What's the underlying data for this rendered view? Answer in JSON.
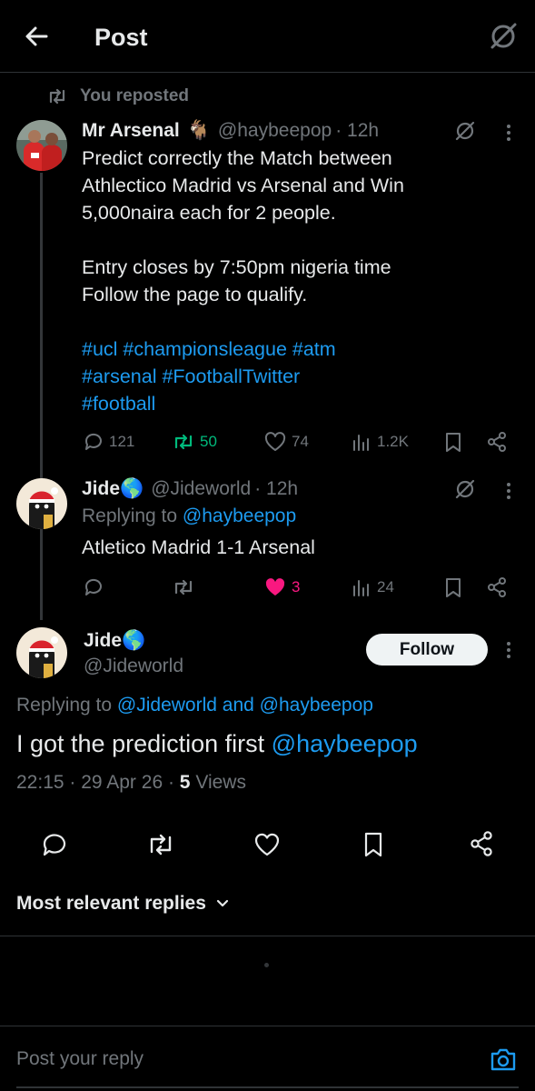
{
  "header": {
    "title": "Post"
  },
  "repost": {
    "label": "You reposted"
  },
  "original_post": {
    "name": "Mr Arsenal",
    "emoji": "🐐",
    "handle": "@haybeepop",
    "time": "· 12h",
    "lines": [
      "Predict correctly the Match between",
      "Athlectico Madrid vs Arsenal and Win",
      "5,000naira each for 2 people.",
      "Entry closes by 7:50pm nigeria time",
      "Follow the page to qualify."
    ],
    "hashtags_line1": "#ucl #championsleague #atm",
    "hashtags_line2": "#arsenal #FootballTwitter",
    "hashtags_line3": "#football",
    "replies": "121",
    "reposts": "50",
    "likes": "74",
    "views": "1.2K",
    "colors": {
      "repost_active": "#00ba7c"
    }
  },
  "reply_post": {
    "name": "Jide",
    "emoji": "🌎",
    "handle": "@Jideworld",
    "time": "· 12h",
    "replying_prefix": "Replying to",
    "replying_to": "@haybeepop",
    "text": "Atletico Madrid 1-1 Arsenal",
    "likes": "3",
    "views": "24",
    "colors": {
      "like_active": "#f91880"
    }
  },
  "main_post": {
    "name": "Jide",
    "emoji": "🌎",
    "handle": "@Jideworld",
    "follow_label": "Follow",
    "replying_prefix": "Replying to",
    "replying_to_1": "@Jideworld",
    "replying_and": "and",
    "replying_to_2": "@haybeepop",
    "text": "I got the prediction first",
    "text_mention": "@haybeepop",
    "time": "22:15 · 29 Apr 26 ·",
    "views_count": "5",
    "views_label": "Views"
  },
  "replies_sort": {
    "label": "Most relevant replies"
  },
  "reply_box": {
    "placeholder": "Post your reply"
  },
  "colors": {
    "background": "#000000",
    "accent": "#1d9bf0",
    "text": "#e7e9ea",
    "muted": "#71767b"
  }
}
